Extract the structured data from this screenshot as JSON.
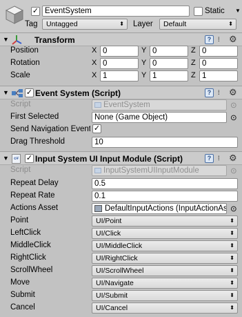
{
  "gameobject": {
    "name": "EventSystem",
    "static_label": "Static",
    "tag_label": "Tag",
    "tag_value": "Untagged",
    "layer_label": "Layer",
    "layer_value": "Default"
  },
  "transform": {
    "title": "Transform",
    "rows": [
      {
        "label": "Position",
        "x": "0",
        "y": "0",
        "z": "0"
      },
      {
        "label": "Rotation",
        "x": "0",
        "y": "0",
        "z": "0"
      },
      {
        "label": "Scale",
        "x": "1",
        "y": "1",
        "z": "1"
      }
    ]
  },
  "axes": {
    "x": "X",
    "y": "Y",
    "z": "Z"
  },
  "event_system": {
    "title": "Event System (Script)",
    "script_label": "Script",
    "script_value": "EventSystem",
    "first_selected_label": "First Selected",
    "first_selected_value": "None (Game Object)",
    "send_nav_label": "Send Navigation Events",
    "drag_label": "Drag Threshold",
    "drag_value": "10"
  },
  "input_module": {
    "title": "Input System UI Input Module (Script)",
    "script_label": "Script",
    "script_value": "InputSystemUIInputModule",
    "repeat_delay_label": "Repeat Delay",
    "repeat_delay_value": "0.5",
    "repeat_rate_label": "Repeat Rate",
    "repeat_rate_value": "0.1",
    "actions_asset_label": "Actions Asset",
    "actions_asset_value": "DefaultInputActions (InputActionAsset)",
    "actions": [
      {
        "label": "Point",
        "value": "UI/Point"
      },
      {
        "label": "LeftClick",
        "value": "UI/Click"
      },
      {
        "label": "MiddleClick",
        "value": "UI/MiddleClick"
      },
      {
        "label": "RightClick",
        "value": "UI/RightClick"
      },
      {
        "label": "ScrollWheel",
        "value": "UI/ScrollWheel"
      },
      {
        "label": "Move",
        "value": "UI/Navigate"
      },
      {
        "label": "Submit",
        "value": "UI/Submit"
      },
      {
        "label": "Cancel",
        "value": "UI/Cancel"
      }
    ]
  },
  "icons": {
    "gear": "⚙",
    "help": "?",
    "settings": "⁞",
    "check": "✓",
    "dropdown_arrow": "▲▼",
    "circle": "⊙",
    "fold": "▼"
  }
}
